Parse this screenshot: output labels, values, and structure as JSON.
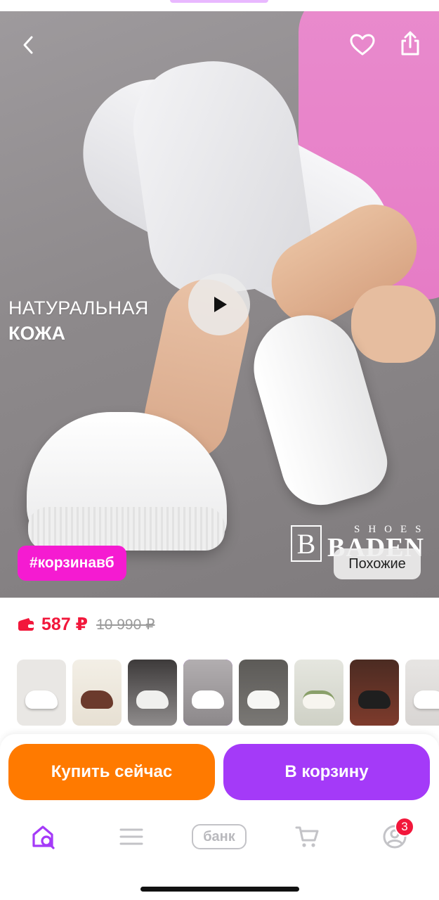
{
  "hero": {
    "promo_line1": "НАТУРАЛЬНАЯ",
    "promo_line2": "КОЖА",
    "brand_mark": "B",
    "brand_small": "SHOES",
    "brand_name": "BADEN",
    "hashtag": "#корзинавб",
    "similar_label": "Похожие"
  },
  "product": {
    "price": "587 ₽",
    "old_price": "10 990 ₽",
    "selected_thumbnail_index": 3,
    "thumbnail_count": 8
  },
  "actions": {
    "buy_now": "Купить сейчас",
    "add_to_cart": "В корзину"
  },
  "tabbar": {
    "bank_label": "банк",
    "profile_badge": "3"
  },
  "colors": {
    "accent": "#a43af8",
    "buy": "#ff7a00",
    "price": "#f2173b",
    "hashtag_bg": "#f51bd1"
  }
}
